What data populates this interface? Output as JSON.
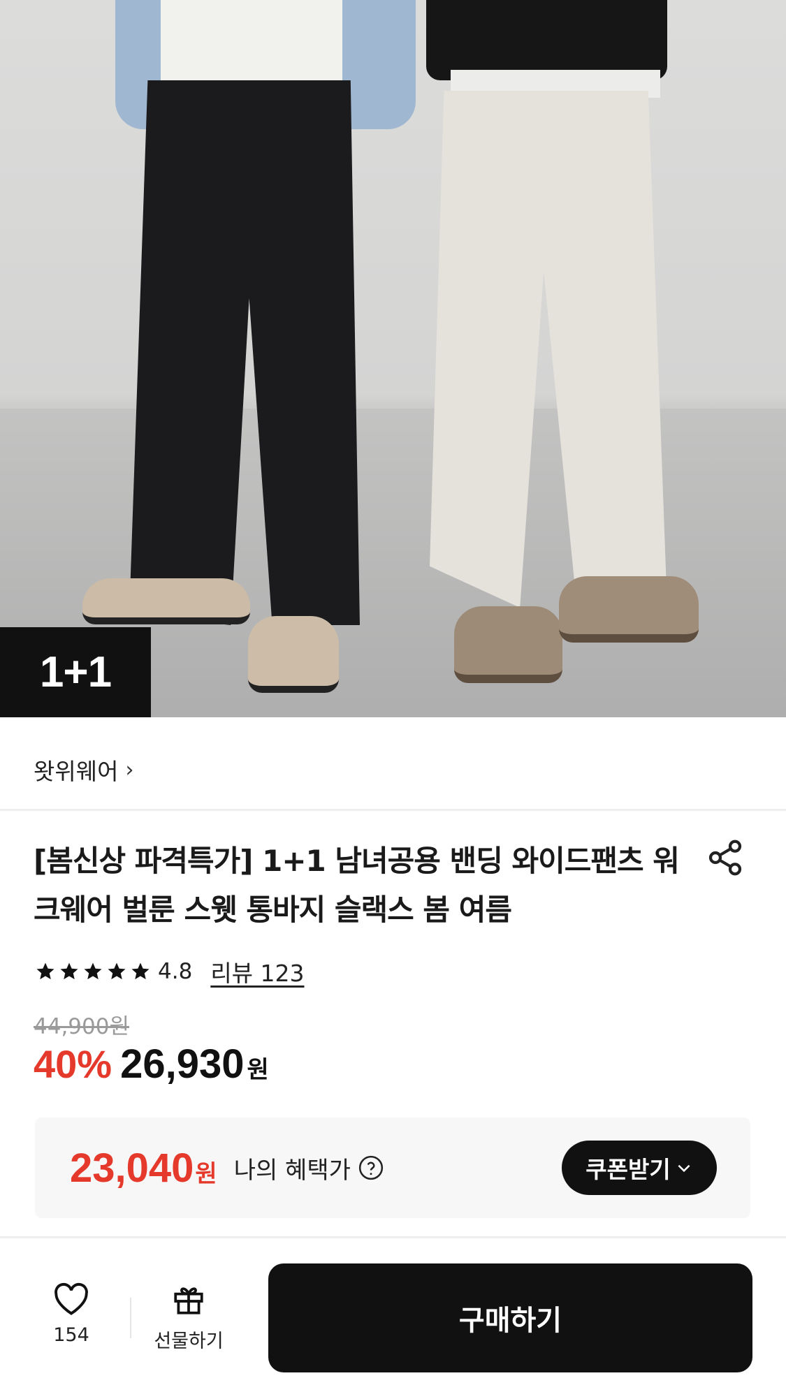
{
  "product_image": {
    "badge_text": "1+1"
  },
  "seller": {
    "name": "왓위웨어",
    "chevron": "›"
  },
  "product": {
    "title": "[봄신상 파격특가] 1+1 남녀공용 밴딩 와이드팬츠 워크웨어 벌룬 스웻 통바지 슬랙스 봄 여름",
    "rating": "4.8",
    "review_label": "리뷰 123",
    "star_count": 5
  },
  "price": {
    "original": "44,900원",
    "discount_rate": "40%",
    "sale_price": "26,930",
    "currency": "원"
  },
  "benefit": {
    "price": "23,040",
    "currency": "원",
    "label": "나의 혜택가",
    "coupon_button": "쿠폰받기"
  },
  "bottom_bar": {
    "like_count": "154",
    "gift_label": "선물하기",
    "buy_label": "구매하기"
  },
  "icons": {
    "share": "share-icon",
    "star": "star-icon",
    "help": "question-circle-icon",
    "chevron_down": "chevron-down-icon",
    "heart": "heart-icon",
    "gift": "gift-icon"
  },
  "colors": {
    "accent_red": "#e5392b",
    "primary_black": "#111111"
  }
}
